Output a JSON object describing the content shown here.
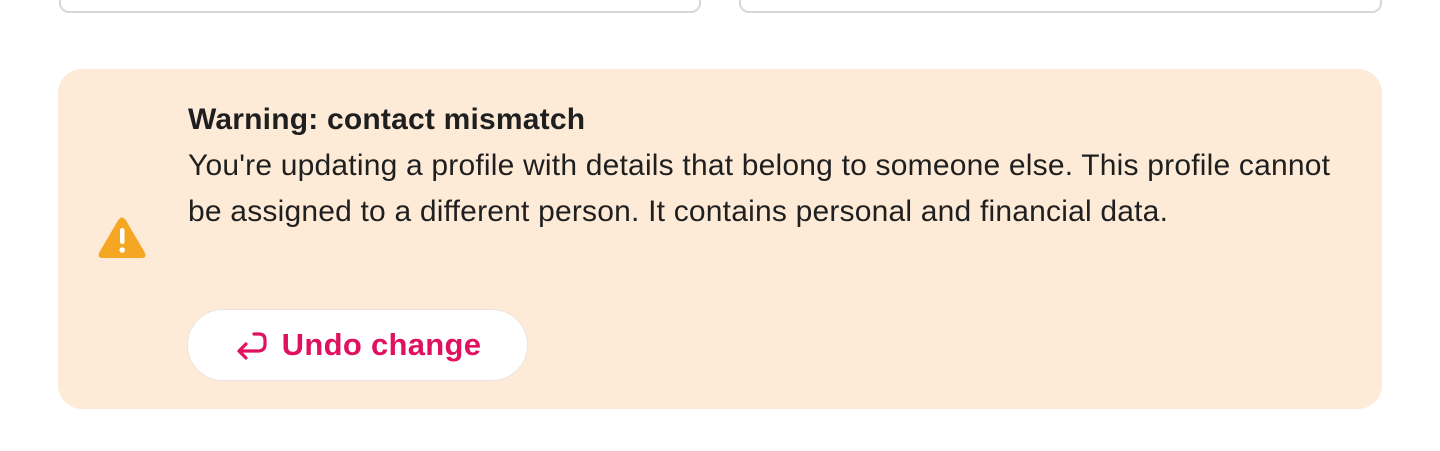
{
  "alert": {
    "title": "Warning: contact mismatch",
    "message": "You're updating a profile with details that belong to someone else. This profile cannot be assigned to a different person. It contains personal and financial data.",
    "icon": "warning-triangle-icon",
    "background_color": "#fdebd8",
    "icon_color": "#f5a623"
  },
  "undo_button": {
    "label": "Undo change",
    "icon": "undo-arrow-icon",
    "color": "#e0115f"
  }
}
